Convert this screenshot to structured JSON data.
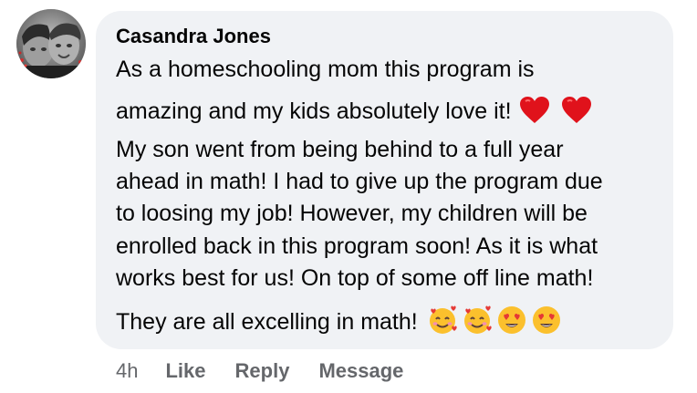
{
  "comment": {
    "author": "Casandra Jones",
    "lines": [
      "As a homeschooling mom this program is",
      "amazing and my kids absolutely love it!",
      "My son went from being behind to a full year",
      "ahead in math! I had to give up the program due",
      "to loosing my job! However, my children will be",
      "enrolled back in this program soon! As it is what",
      "works best for us! On top of some off line math!",
      "They are all excelling in math!"
    ],
    "line2_emojis": [
      "red-heart",
      "red-heart"
    ],
    "line8_emojis": [
      "smiling-face-with-hearts",
      "smiling-face-with-hearts",
      "heart-eyes",
      "heart-eyes"
    ]
  },
  "actions": {
    "timestamp": "4h",
    "like_label": "Like",
    "reply_label": "Reply",
    "message_label": "Message"
  },
  "colors": {
    "bubble": "#f0f2f5",
    "text": "#050505",
    "secondary": "#65676b",
    "heart": "#e0121b",
    "emoji_face": "#fbc02d"
  }
}
